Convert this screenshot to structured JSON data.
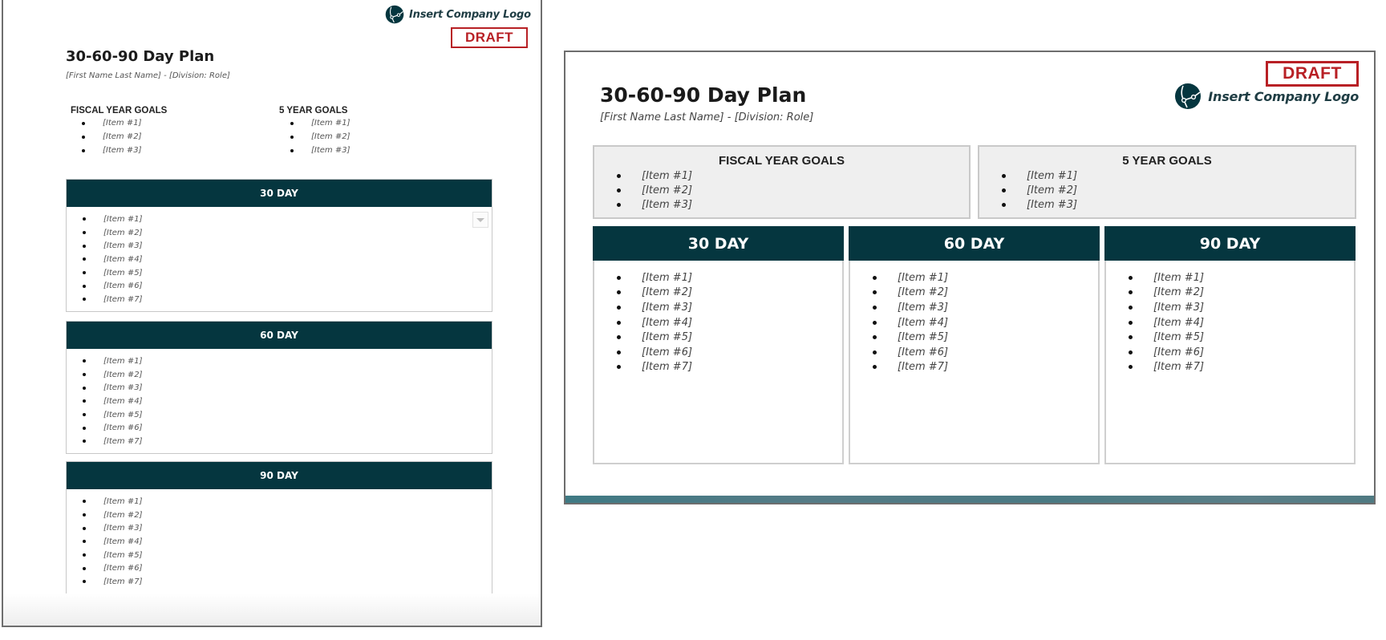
{
  "colors": {
    "header_bg": "#05363f",
    "draft_red": "#b82025",
    "goal_box_bg": "#efefef",
    "logo_text": "#1f3d44"
  },
  "portrait": {
    "logo": {
      "icon": "globe-network-icon",
      "text": "Insert Company Logo"
    },
    "draft_label": "DRAFT",
    "title": "30-60-90 Day Plan",
    "subtitle": "[First Name Last Name] - [Division: Role]",
    "goals": [
      {
        "heading": "FISCAL YEAR GOALS",
        "items": [
          "[Item #1]",
          "[Item #2]",
          "[Item #3]"
        ]
      },
      {
        "heading": "5 YEAR GOALS",
        "items": [
          "[Item #1]",
          "[Item #2]",
          "[Item #3]"
        ]
      }
    ],
    "sections": [
      {
        "heading": "30 DAY",
        "items": [
          "[Item #1]",
          "[Item #2]",
          "[Item #3]",
          "[Item #4]",
          "[Item #5]",
          "[Item #6]",
          "[Item #7]"
        ]
      },
      {
        "heading": "60 DAY",
        "items": [
          "[Item #1]",
          "[Item #2]",
          "[Item #3]",
          "[Item #4]",
          "[Item #5]",
          "[Item #6]",
          "[Item #7]"
        ]
      },
      {
        "heading": "90 DAY",
        "items": [
          "[Item #1]",
          "[Item #2]",
          "[Item #3]",
          "[Item #4]",
          "[Item #5]",
          "[Item #6]",
          "[Item #7]"
        ]
      }
    ]
  },
  "landscape": {
    "draft_label": "DRAFT",
    "logo": {
      "icon": "globe-network-icon",
      "text": "Insert Company Logo"
    },
    "title": "30-60-90 Day Plan",
    "subtitle": "[First Name Last Name] - [Division: Role]",
    "goals": [
      {
        "heading": "FISCAL YEAR GOALS",
        "items": [
          "[Item #1]",
          "[Item #2]",
          "[Item #3]"
        ]
      },
      {
        "heading": "5 YEAR GOALS",
        "items": [
          "[Item #1]",
          "[Item #2]",
          "[Item #3]"
        ]
      }
    ],
    "columns": [
      {
        "heading": "30 DAY",
        "items": [
          "[Item #1]",
          "[Item #2]",
          "[Item #3]",
          "[Item #4]",
          "[Item #5]",
          "[Item #6]",
          "[Item #7]"
        ]
      },
      {
        "heading": "60 DAY",
        "items": [
          "[Item #1]",
          "[Item #2]",
          "[Item #3]",
          "[Item #4]",
          "[Item #5]",
          "[Item #6]",
          "[Item #7]"
        ]
      },
      {
        "heading": "90 DAY",
        "items": [
          "[Item #1]",
          "[Item #2]",
          "[Item #3]",
          "[Item #4]",
          "[Item #5]",
          "[Item #6]",
          "[Item #7]"
        ]
      }
    ]
  }
}
